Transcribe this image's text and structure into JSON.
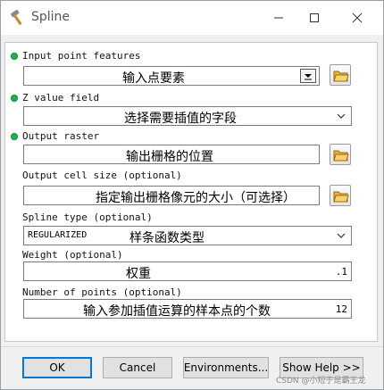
{
  "window": {
    "title": "Spline"
  },
  "fields": {
    "input_point_features": {
      "label": "Input point features",
      "value": "输入点要素"
    },
    "z_value_field": {
      "label": "Z value field",
      "value": "选择需要插值的字段"
    },
    "output_raster": {
      "label": "Output raster",
      "value": "输出栅格的位置"
    },
    "output_cell_size": {
      "label": "Output cell size (optional)",
      "value": "指定输出栅格像元的大小（可选择）"
    },
    "spline_type": {
      "label": "Spline type (optional)",
      "selected": "REGULARIZED",
      "value": "样条函数类型"
    },
    "weight": {
      "label": "Weight (optional)",
      "value": "权重",
      "number": ".1"
    },
    "number_of_points": {
      "label": "Number of points (optional)",
      "value": "输入参加插值运算的样本点的个数",
      "number": "12"
    }
  },
  "buttons": {
    "ok": "OK",
    "cancel": "Cancel",
    "environments": "Environments...",
    "show_help": "Show Help >>"
  },
  "watermark": "CSDN @小短于是霸王龙",
  "colors": {
    "required_dot": "#22b14c",
    "ok_focus": "#0078d7"
  },
  "icons": [
    "hammer-icon",
    "minimize-icon",
    "maximize-icon",
    "close-icon",
    "folder-open-icon",
    "chevron-down-icon",
    "dropdown-arrow-icon"
  ]
}
